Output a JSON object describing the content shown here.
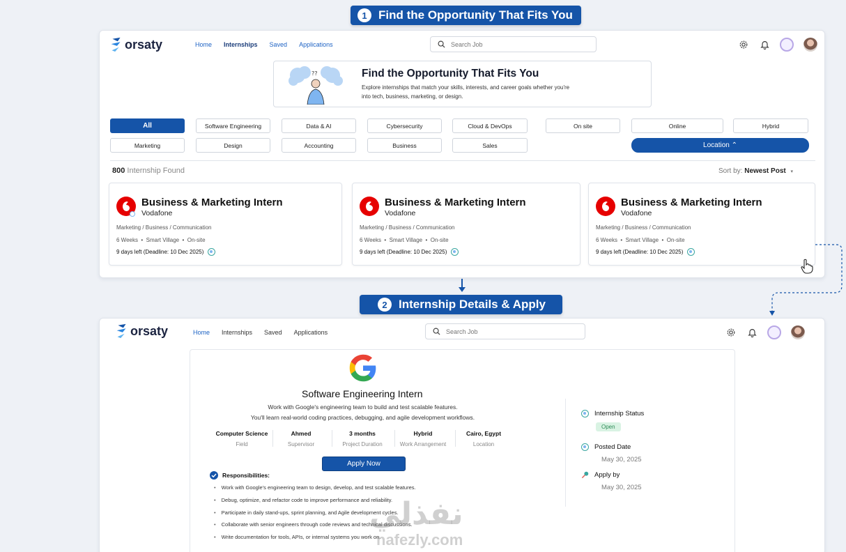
{
  "step1": {
    "number": "1",
    "label": "Find the Opportunity That Fits You"
  },
  "step2": {
    "number": "2",
    "label": "Internship Details & Apply"
  },
  "brand": {
    "name": "orsaty",
    "primary_color": "#1554a8"
  },
  "nav1": {
    "links": [
      "Home",
      "Internships",
      "Saved",
      "Applications"
    ],
    "search_placeholder": "Search Job"
  },
  "hero": {
    "title": "Find the Opportunity That Fits You",
    "subtitle": "Explore internships that match your skills, interests, and career goals whether you're into tech, business, marketing, or design."
  },
  "filters": {
    "row1": [
      "All",
      "Software Engineering",
      "Data & AI",
      "Cybersecurity",
      "Cloud & DevOps",
      "On site",
      "Online",
      "Hybrid"
    ],
    "row2": [
      "Marketing",
      "Design",
      "Accounting",
      "Business",
      "Sales"
    ],
    "location": "Location ⌃"
  },
  "results": {
    "count": "800",
    "count_label": "Internship Found",
    "sort_label": "Sort by:",
    "sort_value": "Newest Post"
  },
  "cards": [
    {
      "title": "Business & Marketing Intern",
      "company": "Vodafone",
      "tags": "Marketing / Business / Communication",
      "meta": "6 Weeks  •  Smart Village  •  On-site",
      "deadline": "9 days left (Deadline: 10 Dec 2025)"
    },
    {
      "title": "Business & Marketing Intern",
      "company": "Vodafone",
      "tags": "Marketing / Business / Communication",
      "meta": "6 Weeks  •  Smart Village  •  On-site",
      "deadline": "9 days left (Deadline: 10 Dec 2025)"
    },
    {
      "title": "Business & Marketing Intern",
      "company": "Vodafone",
      "tags": "Marketing / Business / Communication",
      "meta": "6 Weeks  •  Smart Village  •  On-site",
      "deadline": "9 days left (Deadline: 10 Dec 2025)"
    }
  ],
  "detail": {
    "title": "Software Engineering Intern",
    "desc1": "Work with Google's engineering team to build and test scalable features.",
    "desc2": "You'll learn real-world coding practices, debugging, and agile development workflows.",
    "facts": [
      {
        "value": "Computer Science",
        "label": "Field"
      },
      {
        "value": "Ahmed",
        "label": "Supervisor"
      },
      {
        "value": "3 months",
        "label": "Project Duration"
      },
      {
        "value": "Hybrid",
        "label": "Work Arrangement"
      },
      {
        "value": "Cairo, Egypt",
        "label": "Location"
      }
    ],
    "apply_label": "Apply Now",
    "resp_title": "Responsibilities:",
    "responsibilities": [
      "Work with Google's engineering team to design, develop, and test scalable features.",
      "Debug, optimize, and refactor code to improve performance and reliability.",
      "Participate in daily stand-ups, sprint planning, and Agile development cycles.",
      "Collaborate with senior engineers through code reviews and technical discussions.",
      "Write documentation for tools, APIs, or internal systems you work on."
    ],
    "status_label": "Internship Status",
    "status_value": "Open",
    "posted_label": "Posted Date",
    "posted_value": "May 30, 2025",
    "apply_by_label": "Apply by",
    "apply_by_value": "May 30, 2025"
  },
  "watermark": {
    "arabic": "نفذلي",
    "latin": "nafezly.com"
  }
}
